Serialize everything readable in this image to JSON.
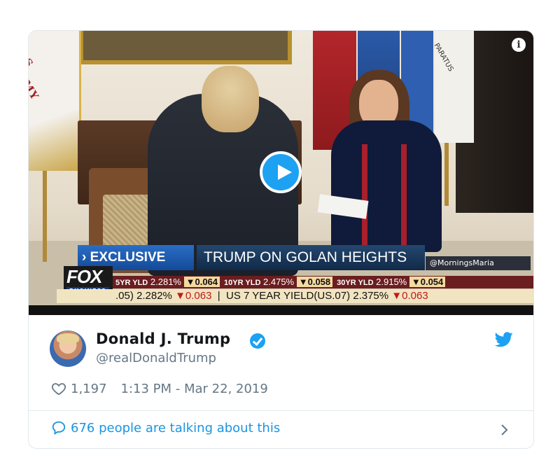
{
  "video": {
    "banner_exclusive": "› EXCLUSIVE",
    "banner_title": "TRUMP ON GOLAN HEIGHTS",
    "banner_handle": "@MorningsMaria",
    "logo_fox": "FOX",
    "logo_business": "BUSINESS",
    "flag_army_text": "S ARMY",
    "flag_white_text": "PARATUS",
    "ticker_row1": [
      {
        "label": "5YR YLD",
        "value": "2.281%",
        "change": "▼0.064"
      },
      {
        "label": "10YR YLD",
        "value": "2.475%",
        "change": "▼0.058"
      },
      {
        "label": "30YR YLD",
        "value": "2.915%",
        "change": "▼0.054"
      }
    ],
    "ticker_row2": {
      "left_value": ".05) 2.282%",
      "left_change": "▼0.063",
      "separator": "|",
      "right_label": "US 7 YEAR YIELD(US.07) 2.375%",
      "right_change": "▼0.063"
    },
    "info_label": "i"
  },
  "tweet": {
    "author_name": "Donald J. Trump",
    "handle": "@realDonaldTrump",
    "likes": "1,197",
    "timestamp": "1:13 PM - Mar 22, 2019",
    "talking": "676 people are talking about this"
  },
  "colors": {
    "twitter_blue": "#1da1f2",
    "link_blue": "#1b95e0",
    "muted_text": "#657786",
    "name_text": "#14171a"
  }
}
